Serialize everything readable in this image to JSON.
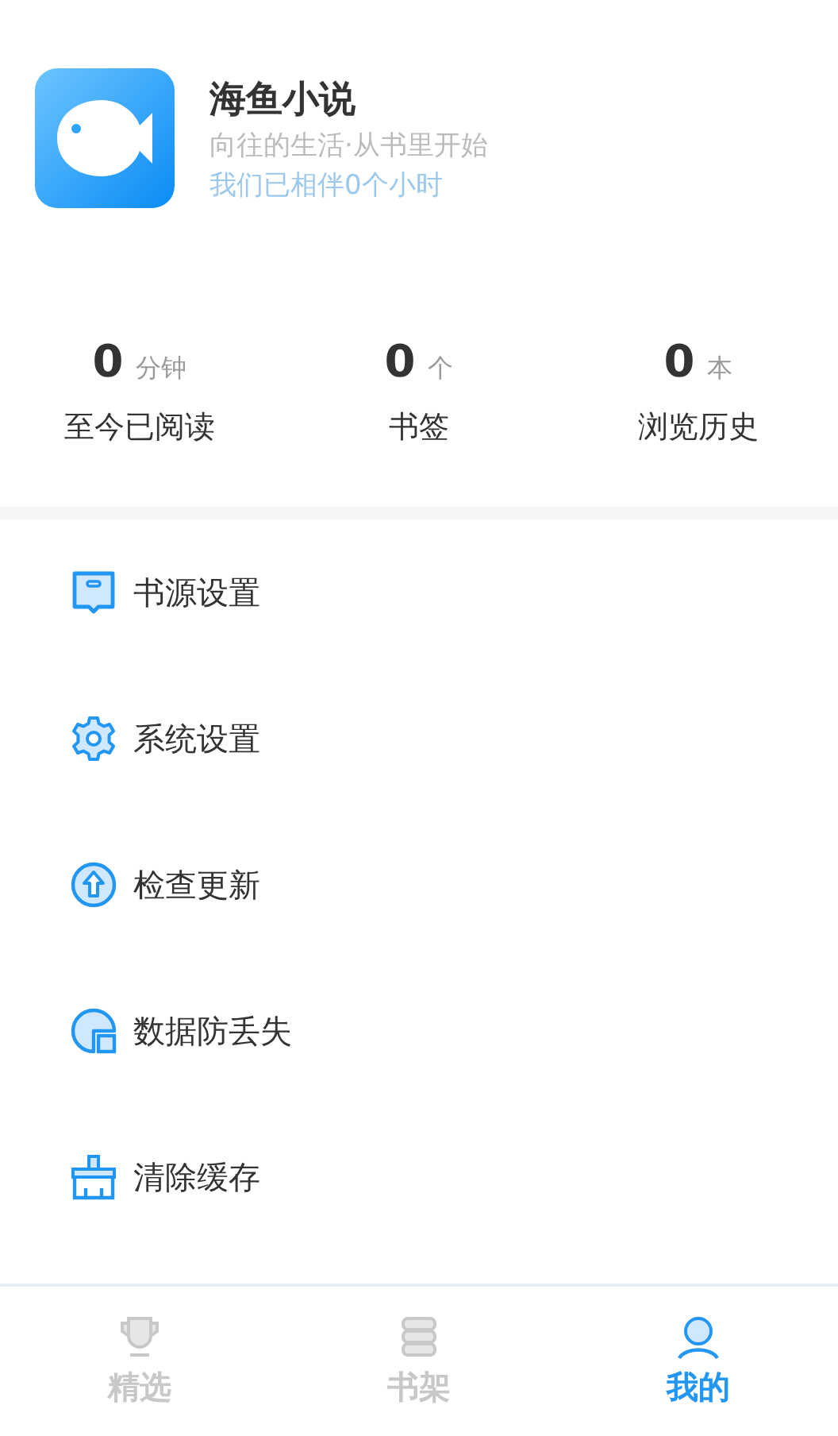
{
  "profile": {
    "app_name": "海鱼小说",
    "slogan": "向往的生活·从书里开始",
    "companion": "我们已相伴0个小时"
  },
  "stats": [
    {
      "value": "0",
      "unit": "分钟",
      "label": "至今已阅读"
    },
    {
      "value": "0",
      "unit": "个",
      "label": "书签"
    },
    {
      "value": "0",
      "unit": "本",
      "label": "浏览历史"
    }
  ],
  "menu": [
    {
      "kind": "source",
      "label": "书源设置"
    },
    {
      "kind": "settings",
      "label": "系统设置"
    },
    {
      "kind": "update",
      "label": "检查更新"
    },
    {
      "kind": "backup",
      "label": "数据防丢失"
    },
    {
      "kind": "clean",
      "label": "清除缓存"
    }
  ],
  "tabs": [
    {
      "kind": "trophy",
      "label": "精选",
      "selected": false
    },
    {
      "kind": "books",
      "label": "书架",
      "selected": false
    },
    {
      "kind": "person",
      "label": "我的",
      "selected": true
    }
  ]
}
